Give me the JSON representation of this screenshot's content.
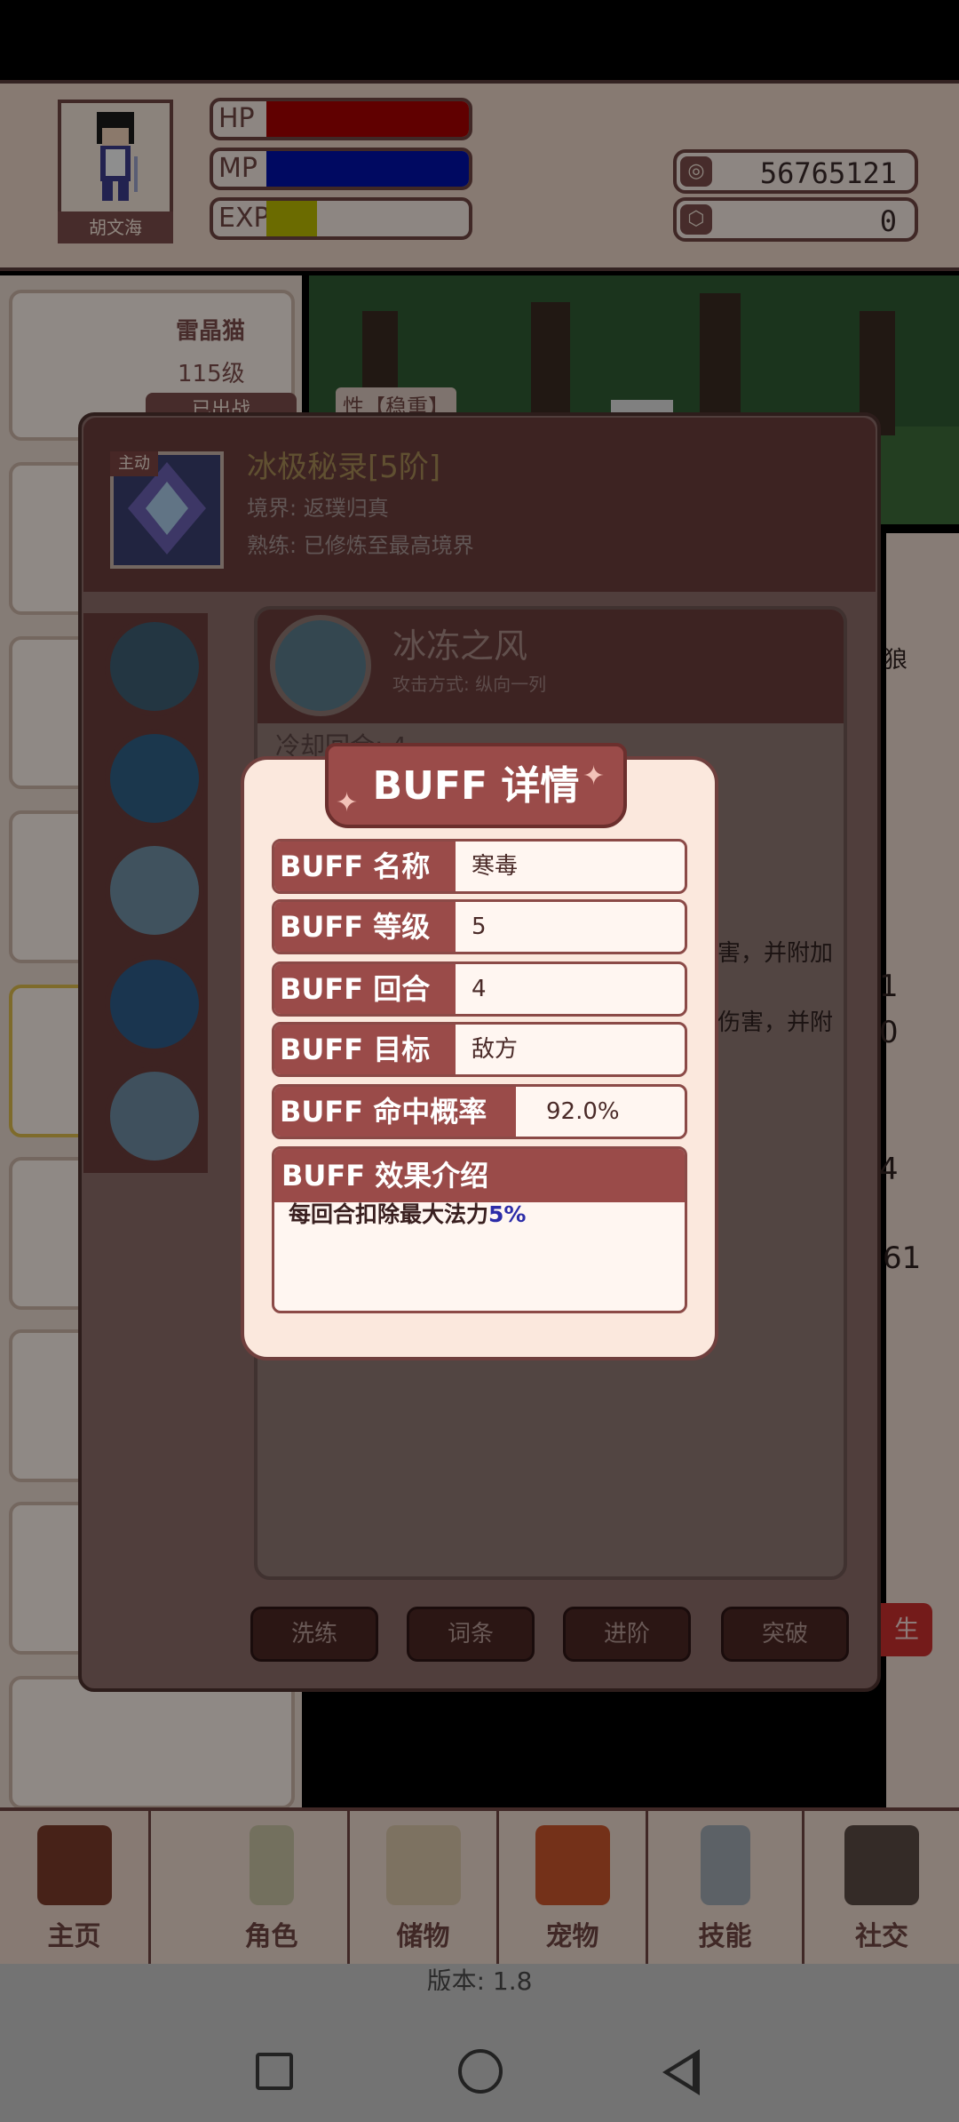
{
  "player": {
    "name": "胡文海",
    "hp_label": "HP",
    "mp_label": "MP",
    "exp_label": "EXP",
    "hp_fraction": 1.0,
    "mp_fraction": 1.0,
    "exp_fraction": 0.25,
    "colors": {
      "hp": "#a50000",
      "mp": "#0010a8",
      "exp": "#b8b800"
    }
  },
  "currency": {
    "gold": "56765121",
    "gems": "0",
    "gold_icon": "coin-icon",
    "gem_icon": "gem-icon"
  },
  "pet_list": {
    "first": {
      "name": "雷晶猫",
      "level": "115级",
      "status": "已出战"
    }
  },
  "scene": {
    "partial_text": "性【稳重】"
  },
  "skill": {
    "badge": "主动",
    "title": "冰极秘录[5阶]",
    "realm": "境界: 返璞归真",
    "proficiency": "熟练: 已修炼至最高境界",
    "detail_name": "冰冻之风",
    "attack_mode": "攻击方式: 纵向一列",
    "cooldown": "冷却回合: 4",
    "side_texts": [
      "狼",
      "害，并附加",
      "伤害，并附",
      "1",
      "0",
      "4",
      "61"
    ],
    "buttons": [
      "洗练",
      "词条",
      "进阶",
      "突破"
    ],
    "right_button": "生"
  },
  "buff_dialog": {
    "title": "BUFF 详情",
    "rows": [
      {
        "label": "BUFF 名称",
        "value": "寒毒"
      },
      {
        "label": "BUFF 等级",
        "value": "5"
      },
      {
        "label": "BUFF 回合",
        "value": "4"
      },
      {
        "label": "BUFF 目标",
        "value": "敌方"
      },
      {
        "label": "BUFF 命中概率",
        "value": "92.0%"
      }
    ],
    "effect_label": "BUFF 效果介绍",
    "effect_text": "每回合扣除最大法力",
    "effect_highlight": "5%"
  },
  "nav": {
    "items": [
      "主页",
      "角色",
      "储物",
      "宠物",
      "技能",
      "社交"
    ]
  },
  "version_text": "版本: 1.8"
}
